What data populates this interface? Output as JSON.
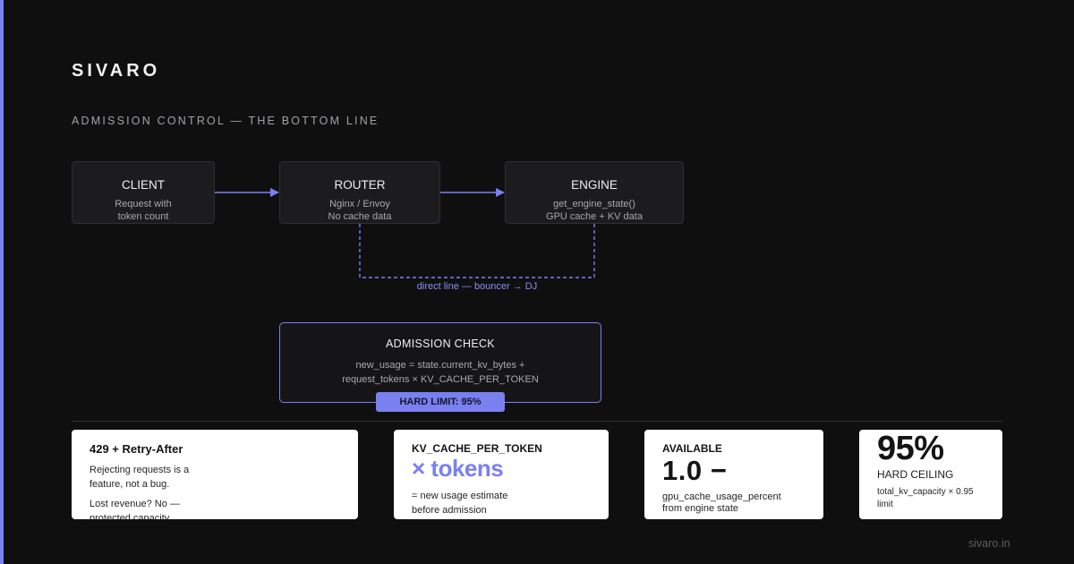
{
  "brand": "SIVARO",
  "subtitle": "ADMISSION CONTROL — THE BOTTOM LINE",
  "nodes": {
    "client": {
      "title": "CLIENT",
      "lines": [
        "Request with",
        "token count"
      ]
    },
    "router": {
      "title": "ROUTER",
      "lines": [
        "Nginx / Envoy",
        "No cache data"
      ]
    },
    "engine": {
      "title": "ENGINE",
      "lines": [
        "get_engine_state()",
        "GPU cache + KV data"
      ]
    }
  },
  "direct_line_label": "direct line — bouncer → DJ",
  "admission_check": {
    "title": "ADMISSION CHECK",
    "formula_lines": [
      "new_usage = state.current_kv_bytes +",
      "request_tokens × KV_CACHE_PER_TOKEN"
    ],
    "badge": "HARD LIMIT: 95%"
  },
  "cards": {
    "reject": {
      "title": "429 + Retry-After",
      "text1": "Rejecting requests is a feature, not a bug.",
      "text2": "Lost revenue? No — protected capacity."
    },
    "kv": {
      "title": "KV_CACHE_PER_TOKEN",
      "big": "× tokens",
      "text": "= new usage estimate before admission"
    },
    "available": {
      "title": "AVAILABLE",
      "big": "1.0 −",
      "text": "gpu_cache_usage_percent from engine state"
    },
    "ceiling": {
      "big": "95%",
      "title": "HARD CEILING",
      "text": "total_kv_capacity × 0.95 limit"
    }
  },
  "footer": "sivaro.in",
  "colors": {
    "accent": "#7b80f0",
    "background": "#0f0f10",
    "node_fill": "#1c1c1f",
    "card": "#ffffff"
  }
}
